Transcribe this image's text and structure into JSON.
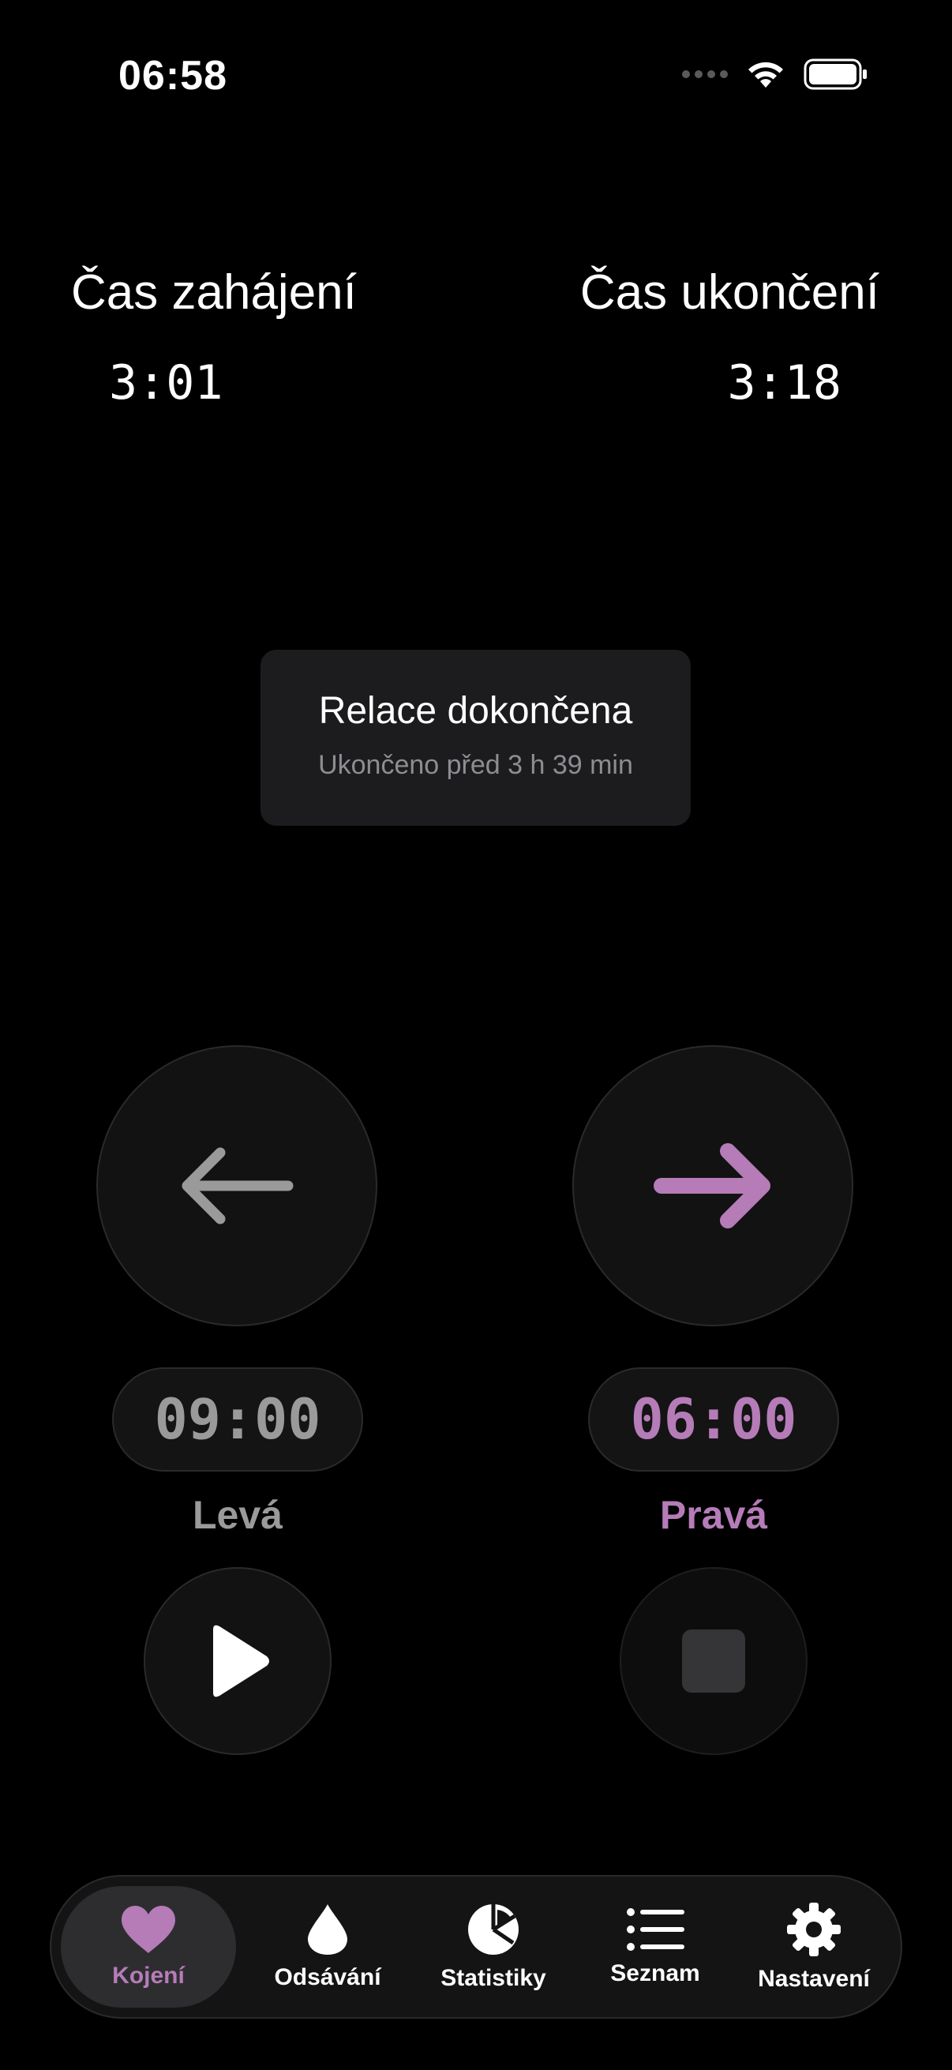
{
  "status_bar": {
    "time": "06:58"
  },
  "times": {
    "start_label": "Čas zahájení",
    "start_value": "3:01",
    "end_label": "Čas ukončení",
    "end_value": "3:18"
  },
  "session": {
    "title": "Relace dokončena",
    "subtitle": "Ukončeno před 3 h 39 min"
  },
  "sides": {
    "left": {
      "icon": "arrow-left-icon",
      "timer": "09:00",
      "label": "Levá",
      "color": "#9a9a9a"
    },
    "right": {
      "icon": "arrow-right-icon",
      "timer": "06:00",
      "label": "Pravá",
      "color": "#b57cb8"
    }
  },
  "controls": {
    "play_icon": "play-icon",
    "stop_icon": "stop-icon"
  },
  "tab_bar": {
    "items": [
      {
        "label": "Kojení",
        "icon": "heart-icon",
        "active": true
      },
      {
        "label": "Odsávání",
        "icon": "drop-icon",
        "active": false
      },
      {
        "label": "Statistiky",
        "icon": "pie-chart-icon",
        "active": false
      },
      {
        "label": "Seznam",
        "icon": "list-icon",
        "active": false
      },
      {
        "label": "Nastavení",
        "icon": "gear-icon",
        "active": false
      }
    ]
  },
  "colors": {
    "accent": "#b57cb8",
    "background": "#000000",
    "inactive": "#9a9a9a"
  }
}
